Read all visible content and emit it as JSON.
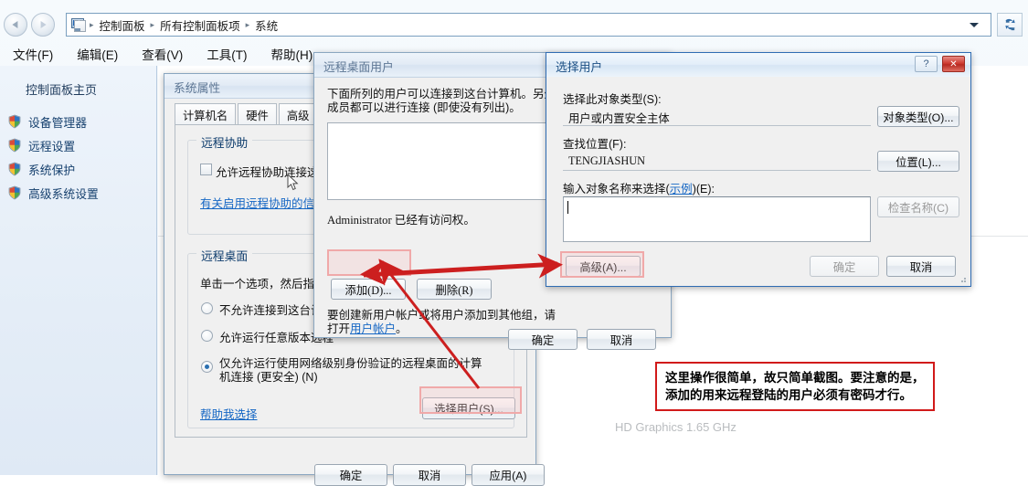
{
  "window": {
    "breadcrumb": {
      "icon": "computer-icon",
      "items": [
        "控制面板",
        "所有控制面板项",
        "系统"
      ],
      "separator": "▸"
    },
    "toolbar": {
      "dropdown_icon": "chevron-down-icon",
      "refresh_icon": "refresh-icon"
    },
    "menubar": [
      "文件(F)",
      "编辑(E)",
      "查看(V)",
      "工具(T)",
      "帮助(H)"
    ],
    "sidebar": {
      "header": "控制面板主页",
      "items": [
        {
          "icon": "shield-icon",
          "label": "设备管理器"
        },
        {
          "icon": "shield-icon",
          "label": "远程设置"
        },
        {
          "icon": "shield-icon",
          "label": "系统保护"
        },
        {
          "icon": "shield-icon",
          "label": "高级系统设置"
        }
      ]
    },
    "background_text": "HD Graphics   1.65 GHz"
  },
  "system_properties": {
    "title": "系统属性",
    "tabs": [
      "计算机名",
      "硬件",
      "高级"
    ],
    "remote_assistance": {
      "group_title": "远程协助",
      "checkbox_label": "允许远程协助连接这台",
      "checkbox_checked": false,
      "link": "有关启用远程协助的信息"
    },
    "remote_desktop": {
      "group_title": "远程桌面",
      "intro": "单击一个选项，然后指定",
      "options": [
        {
          "label": "不允许连接到这台计算",
          "selected": false
        },
        {
          "label": "允许运行任意版本远程",
          "selected": false
        },
        {
          "label": "仅允许运行使用网络级别身份验证的远程桌面的计算\n机连接 (更安全) (N)",
          "selected": true
        }
      ],
      "help_link": "帮助我选择",
      "select_users_button": "选择用户(S)..."
    },
    "buttons": {
      "ok": "确定",
      "cancel": "取消",
      "apply": "应用(A)"
    }
  },
  "remote_desktop_users": {
    "title": "远程桌面用户",
    "description": "下面所列的用户可以连接到这台计算机。另外，管理员组的任何\n成员都可以进行连接 (即使没有列出)。",
    "list_items": [],
    "access_note": "Administrator 已经有访问权。",
    "add_button": "添加(D)...",
    "remove_button": "删除(R)",
    "hint_prefix": "要创建新用户帐户或将用户添加到其他组，请\n打开",
    "hint_link": "用户帐户",
    "hint_suffix": "。",
    "buttons": {
      "ok": "确定",
      "cancel": "取消"
    }
  },
  "select_users": {
    "title": "选择用户",
    "help_button": "?",
    "close_button": "✕",
    "object_type_label": "选择此对象类型(S):",
    "object_type_value": "用户或内置安全主体",
    "object_type_button": "对象类型(O)...",
    "location_label": "查找位置(F):",
    "location_value": "TENGJIASHUN",
    "location_button": "位置(L)...",
    "names_label_prefix": "输入对象名称来选择(",
    "names_label_link": "示例",
    "names_label_suffix": ")(E):",
    "names_value": "",
    "check_names_button": "检查名称(C)",
    "advanced_button": "高级(A)...",
    "ok_button": "确定",
    "cancel_button": "取消"
  },
  "annotation": {
    "note_line1": "这里操作很简单，故只简单截图。要注意的是，",
    "note_line2": "添加的用来远程登陆的用户必须有密码才行。",
    "border_color": "#d11a1a",
    "highlight_color": "#f0a9a9",
    "arrow_color": "#cc1f1f",
    "highlights": [
      "添加(D)...",
      "高级(A)...",
      "选择用户(S)..."
    ]
  }
}
